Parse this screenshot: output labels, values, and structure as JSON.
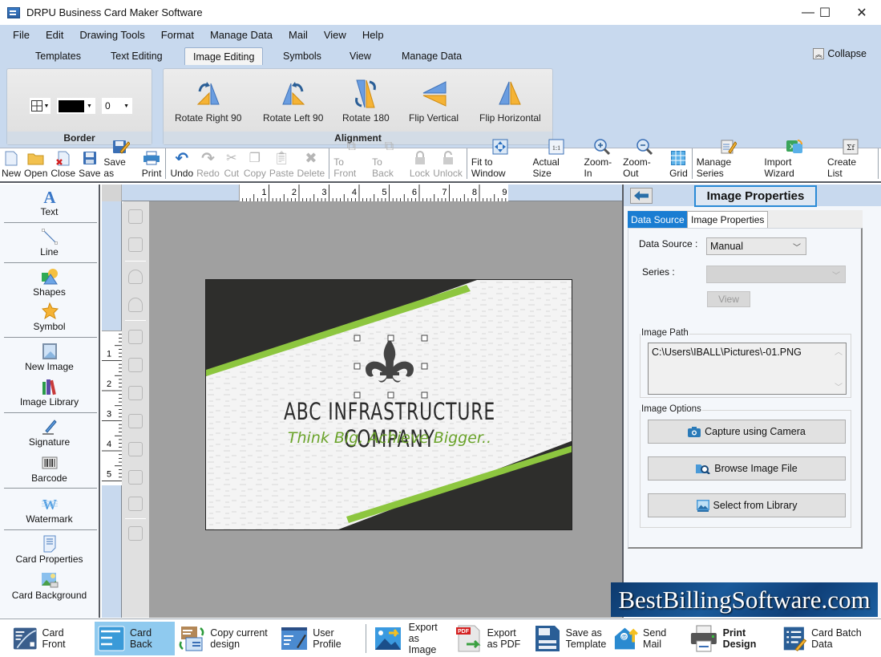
{
  "window": {
    "title": "DRPU Business Card Maker Software",
    "controls": {
      "minimize": "—",
      "maximize": "☐",
      "close": "✕"
    }
  },
  "menu": [
    "File",
    "Edit",
    "Drawing Tools",
    "Format",
    "Manage Data",
    "Mail",
    "View",
    "Help"
  ],
  "ribbon_tabs": {
    "items": [
      "Templates",
      "Text Editing",
      "Image Editing",
      "Symbols",
      "View",
      "Manage Data"
    ],
    "active": "Image Editing",
    "collapse_label": "Collapse"
  },
  "ribbon": {
    "border_group": {
      "label": "Border",
      "width_value": "0",
      "color": "#000000"
    },
    "alignment_group": {
      "label": "Alignment",
      "buttons": [
        "Rotate Right 90",
        "Rotate Left 90",
        "Rotate 180",
        "Flip Vertical",
        "Flip Horizontal"
      ]
    }
  },
  "toolbar": {
    "file": [
      "New",
      "Open",
      "Close",
      "Save",
      "Save as",
      "Print"
    ],
    "edit": [
      "Undo",
      "Redo",
      "Cut",
      "Copy",
      "Paste",
      "Delete"
    ],
    "arrange": [
      "To Front",
      "To Back",
      "Lock",
      "Unlock"
    ],
    "view": [
      "Fit to Window",
      "Actual Size",
      "Zoom-In",
      "Zoom-Out",
      "Grid"
    ],
    "data": [
      "Manage Series",
      "Import Wizard",
      "Create List"
    ]
  },
  "left_tools": [
    "Text",
    "Line",
    "Shapes",
    "Symbol",
    "New Image",
    "Image Library",
    "Signature",
    "Barcode",
    "Watermark",
    "Card Properties",
    "Card Background"
  ],
  "ruler": {
    "top_ticks": [
      "1",
      "2",
      "3",
      "4",
      "5",
      "6",
      "7",
      "8",
      "9"
    ],
    "left_ticks": [
      "1",
      "2",
      "3",
      "4",
      "5"
    ]
  },
  "card": {
    "company": "ABC INFRASTRUCTURE COMPANY",
    "tagline": "Think Big, Achieve Bigger..",
    "accent_color": "#8dc63f",
    "dark_color": "#2e2e2c"
  },
  "right_panel": {
    "title": "Image Properties",
    "tabs": [
      "Data Source",
      "Image Properties"
    ],
    "active_tab": "Data Source",
    "data_source_label": "Data Source :",
    "data_source_value": "Manual",
    "series_label": "Series :",
    "series_value": "",
    "view_button": "View",
    "image_path_legend": "Image Path",
    "image_path_value": "C:\\Users\\IBALL\\Pictures\\-01.PNG",
    "image_options_legend": "Image Options",
    "buttons": [
      "Capture using Camera",
      "Browse Image File",
      "Select from Library"
    ]
  },
  "watermark": "BestBillingSoftware.com",
  "bottom_bar": [
    {
      "label": "Card Front"
    },
    {
      "label": "Card Back",
      "active": true
    },
    {
      "label": "Copy current design"
    },
    {
      "label": "User Profile"
    },
    {
      "label": "Export as Image"
    },
    {
      "label": "Export as PDF"
    },
    {
      "label": "Save as Template"
    },
    {
      "label": "Send Mail"
    },
    {
      "label": "Print Design",
      "bold": true
    },
    {
      "label": "Card Batch Data"
    }
  ]
}
